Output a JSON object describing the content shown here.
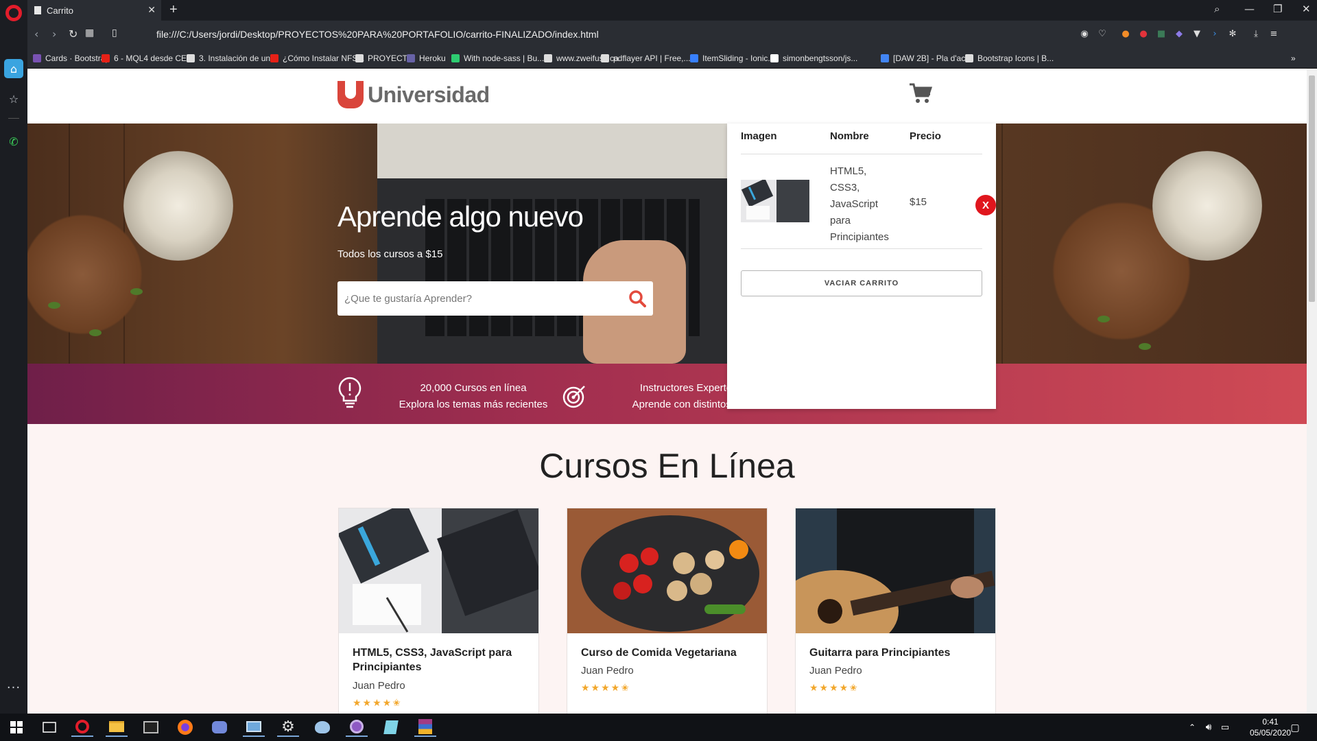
{
  "browser": {
    "tab_title": "Carrito",
    "url": "file:///C:/Users/jordi/Desktop/PROYECTOS%20PARA%20PORTAFOLIO/carrito-FINALIZADO/index.html",
    "bookmarks": [
      {
        "label": "Cards · Bootstrap",
        "icon": "bootstrap-icon",
        "color": "#7952b3"
      },
      {
        "label": "6 - MQL4 desde CE...",
        "icon": "youtube-icon",
        "color": "#e62117"
      },
      {
        "label": "3. Instalación de un...",
        "icon": "page-icon",
        "color": "#dddddd"
      },
      {
        "label": "¿Cómo Instalar NFS...",
        "icon": "youtube-icon",
        "color": "#e62117"
      },
      {
        "label": "PROYECTO",
        "icon": "folder-icon",
        "color": "#dddddd"
      },
      {
        "label": "Heroku",
        "icon": "heroku-icon",
        "color": "#6762a6"
      },
      {
        "label": "With node-sass | Bu...",
        "icon": "leaf-icon",
        "color": "#2ecc71"
      },
      {
        "label": "www.zweifuss.ca",
        "icon": "page-icon",
        "color": "#dddddd"
      },
      {
        "label": "pdflayer API | Free,...",
        "icon": "tool-icon",
        "color": "#dddddd"
      },
      {
        "label": "ItemSliding - Ionic...",
        "icon": "ionic-icon",
        "color": "#3880ff"
      },
      {
        "label": "simonbengtsson/js...",
        "icon": "github-icon",
        "color": "#ffffff"
      },
      {
        "label": "[DAW 2B] - Pla d'ac...",
        "icon": "docs-icon",
        "color": "#4285f4"
      },
      {
        "label": "Bootstrap Icons | B...",
        "icon": "page-icon",
        "color": "#dddddd"
      }
    ],
    "bookmarks_more": "»"
  },
  "site": {
    "brand": "Universidad",
    "hero_title": "Aprende algo nuevo",
    "hero_subtitle": "Todos los cursos a $15",
    "search_placeholder": "¿Que te gustaría Aprender?",
    "features": [
      {
        "line1": "20,000 Cursos en línea",
        "line2": "Explora los temas más recientes",
        "icon": "lightbulb-icon"
      },
      {
        "line1": "Instructores Experto",
        "line2": "Aprende con distintos e",
        "icon": "target-icon"
      }
    ],
    "courses_title": "Cursos En Línea",
    "courses": [
      {
        "title": "HTML5, CSS3, JavaScript para Principiantes",
        "author": "Juan Pedro",
        "rating": 4.5,
        "stars": "★★★★✬"
      },
      {
        "title": "Curso de Comida Vegetariana",
        "author": "Juan Pedro",
        "rating": 4.5,
        "stars": "★★★★✬"
      },
      {
        "title": "Guitarra para Principiantes",
        "author": "Juan Pedro",
        "rating": 4.5,
        "stars": "★★★★✬"
      }
    ]
  },
  "cart": {
    "headers": {
      "image": "Imagen",
      "name": "Nombre",
      "price": "Precio"
    },
    "items": [
      {
        "name": "HTML5, CSS3, JavaScript para Principiantes",
        "price": "$15",
        "remove_label": "X"
      }
    ],
    "empty_label": "VACIAR CARRITO"
  },
  "taskbar": {
    "time": "0:41",
    "date": "05/05/2020"
  },
  "colors": {
    "brand_red": "#d9453b",
    "banner_start": "#6f1f49",
    "banner_end": "#cf4a55",
    "remove_red": "#e0161d",
    "star": "#f2a72c"
  }
}
